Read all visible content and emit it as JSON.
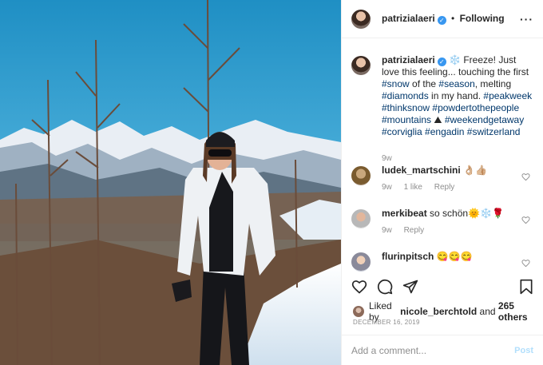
{
  "header": {
    "username": "patrizialaeri",
    "dot": "•",
    "follow_label": "Following",
    "more_icon": "more-horizontal-icon",
    "more_text": "···"
  },
  "caption": {
    "username": "patrizialaeri",
    "text_1": " ❄️ Freeze! Just love this feeling... touching the first ",
    "tag_snow": "#snow",
    "text_2": " of the ",
    "tag_season": "#season",
    "text_3": ", melting ",
    "tag_diamonds": "#diamonds",
    "text_4": " in my hand. ",
    "tag_peakweek": "#peakweek",
    "tag_thinksnow": "#thinksnow",
    "tag_powder": "#powdertothepeople",
    "tag_mountains": "#mountains",
    "mountain_emoji": " ⛰",
    "tag_weekend": "#weekendgetaway",
    "tag_corviglia": "#corviglia",
    "tag_engadin": "#engadin",
    "tag_switzerland": "#switzerland",
    "time": "9w"
  },
  "comments": [
    {
      "username": "ludek_martschini",
      "text": "👌🏼👍🏼",
      "time": "9w",
      "likes": "1 like",
      "reply": "Reply"
    },
    {
      "username": "merkibeat",
      "text": "so schön🌞❄️🌹",
      "time": "9w",
      "reply": "Reply"
    },
    {
      "username": "flurinpitsch",
      "text": "😋😋😋"
    }
  ],
  "likes": {
    "prefix": "Liked by ",
    "user": "nicole_berchtold",
    "middle": " and ",
    "count": "265 others"
  },
  "date": "DECEMBER 16, 2019",
  "add_comment": {
    "placeholder": "Add a comment...",
    "post_label": "Post"
  },
  "colors": {
    "link": "#00376b",
    "verified": "#3897f0",
    "post_disabled": "#b2dffc",
    "meta": "#8e8e8e"
  }
}
